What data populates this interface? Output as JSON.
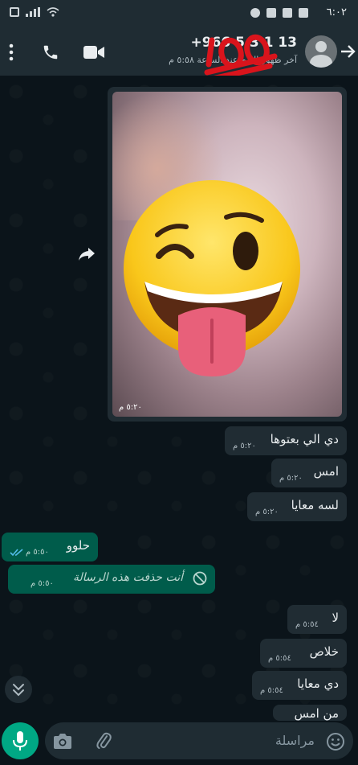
{
  "status_bar": {
    "time": "٦:٠٢"
  },
  "header": {
    "title": "+966 5 3 1 13",
    "subtitle": "آخر ظهور اليوم عند الساعة ٥:٥٨ م"
  },
  "media_message": {
    "time": "٥:٢٠ م"
  },
  "messages": [
    {
      "text": "دي الي بعتوها",
      "time": "٥:٢٠ م"
    },
    {
      "text": "امس",
      "time": "٥:٢٠ م"
    },
    {
      "text": "لسه معايا",
      "time": "٥:٢٠ م"
    },
    {
      "text": "حلوو",
      "time": "٥:٥٠ م"
    },
    {
      "text": "لا",
      "time": "٥:٥٤ م"
    },
    {
      "text": "خلاص",
      "time": "٥:٥٤ م"
    },
    {
      "text": "دي معايا",
      "time": "٥:٥٤ م"
    },
    {
      "text": "من امس",
      "time": ""
    }
  ],
  "deleted_message": {
    "text": "أنت حذفت هذه الرسالة",
    "time": "٥:٥٠ م"
  },
  "composer": {
    "placeholder": "مراسلة"
  },
  "colors": {
    "background": "#0b141a",
    "header": "#1f2c33",
    "incoming_bubble": "#202c33",
    "outgoing_bubble": "#005c4b",
    "accent": "#00a884",
    "read_ticks": "#53bdeb"
  }
}
